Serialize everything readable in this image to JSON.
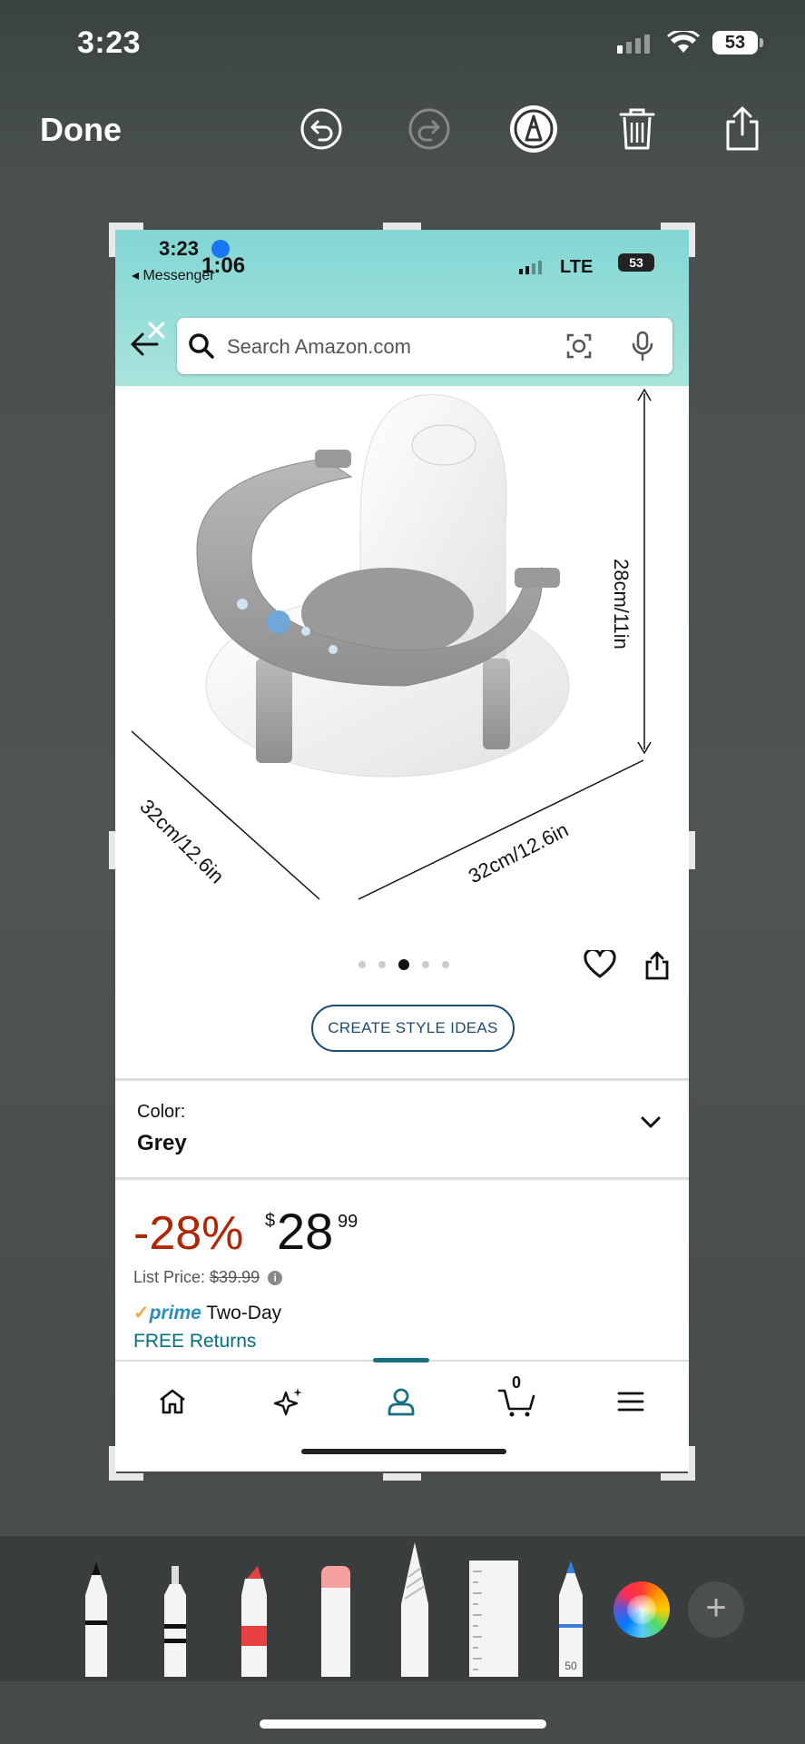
{
  "status_bar": {
    "time": "3:23",
    "battery": "53"
  },
  "toolbar": {
    "done_label": "Done"
  },
  "inner": {
    "status_time": "3:23",
    "overlay_time": "1:06",
    "back_app": "◂ Messenger",
    "network": "LTE",
    "battery": "53"
  },
  "search": {
    "placeholder": "Search Amazon.com"
  },
  "product_image": {
    "height_label": "28cm/11in",
    "depth_label": "32cm/12.6in",
    "width_label": "32cm/12.6in",
    "carousel_index": 3,
    "carousel_count": 5
  },
  "style_ideas_label": "CREATE STYLE IDEAS",
  "color": {
    "label": "Color:",
    "value": "Grey"
  },
  "price": {
    "discount": "-28%",
    "currency": "$",
    "whole": "28",
    "fraction": "99",
    "list_label": "List Price:",
    "list_value": "$39.99"
  },
  "shipping": {
    "prime": "prime",
    "speed": "Two-Day",
    "returns": "FREE Returns"
  },
  "bottom_nav": {
    "cart_count": "0"
  },
  "palette": {
    "pencil_width": "50"
  },
  "colors": {
    "amazon_teal": "#007185",
    "discount_red": "#b12704",
    "prime_blue": "#2a8fbd",
    "header_teal": "#82d6d4"
  }
}
